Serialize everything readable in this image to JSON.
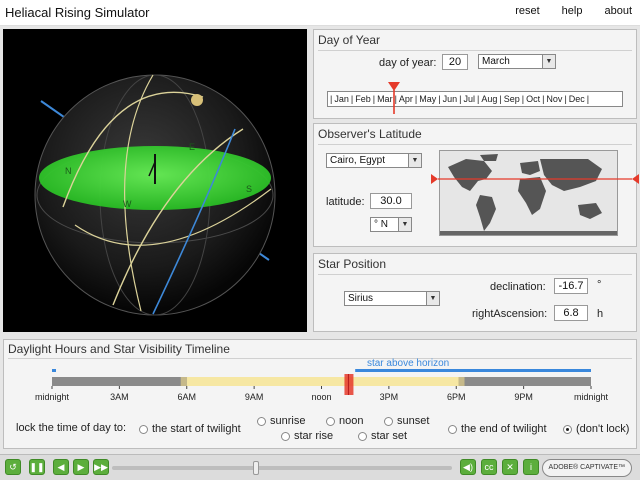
{
  "app": {
    "title": "Heliacal Rising Simulator",
    "links": [
      "reset",
      "help",
      "about"
    ]
  },
  "sphere": {
    "directions": {
      "north": "N",
      "west": "W",
      "south": "S",
      "east": "E"
    },
    "colors": {
      "horizon": "#33cc33",
      "ecliptic": "#3d88d8",
      "celestial": "#dcd39a",
      "sun": "#d8c078"
    }
  },
  "day_panel": {
    "title": "Day of Year",
    "day_label": "day of year:",
    "day_value": "20",
    "month_value": "March",
    "months": [
      "Jan",
      "Feb",
      "Mar",
      "Apr",
      "May",
      "Jun",
      "Jul",
      "Aug",
      "Sep",
      "Oct",
      "Nov",
      "Dec"
    ],
    "marker_color": "#e53a2a"
  },
  "lat_panel": {
    "title": "Observer's Latitude",
    "location_value": "Cairo, Egypt",
    "lat_label": "latitude:",
    "lat_value": "30.0",
    "hemisphere_value": "° N"
  },
  "star_panel": {
    "title": "Star Position",
    "star_value": "Sirius",
    "dec_label": "declination:",
    "dec_value": "-16.7",
    "dec_unit": "°",
    "ra_label": "rightAscension:",
    "ra_value": "6.8",
    "ra_unit": "h"
  },
  "timeline": {
    "title": "Daylight Hours and Star Visibility Timeline",
    "above_horizon_label": "star above horizon",
    "above_horizon_color": "#3a88dc",
    "ticks": [
      {
        "hour": 0,
        "label": "midnight"
      },
      {
        "hour": 3,
        "label": "3AM"
      },
      {
        "hour": 6,
        "label": "6AM"
      },
      {
        "hour": 9,
        "label": "9AM"
      },
      {
        "hour": 12,
        "label": "noon"
      },
      {
        "hour": 15,
        "label": "3PM"
      },
      {
        "hour": 18,
        "label": "6PM"
      },
      {
        "hour": 21,
        "label": "9PM"
      },
      {
        "hour": 24,
        "label": "midnight"
      }
    ],
    "star_above_start_hour": 13.5,
    "star_above_end_hour": 24,
    "day_start_hour": 6.0,
    "day_end_hour": 18.1,
    "cursor_hour": 13.2,
    "lock_label": "lock the time of day to:",
    "options": [
      {
        "label": "the start of twilight",
        "checked": false
      },
      {
        "label": "sunrise",
        "checked": false
      },
      {
        "label": "noon",
        "checked": false
      },
      {
        "label": "sunset",
        "checked": false
      },
      {
        "label": "star rise",
        "checked": false
      },
      {
        "label": "star set",
        "checked": false
      },
      {
        "label": "the end of twilight",
        "checked": false
      },
      {
        "label": "(don't lock)",
        "checked": true
      }
    ]
  },
  "player": {
    "badge": "ADOBE® CAPTIVATE™"
  }
}
